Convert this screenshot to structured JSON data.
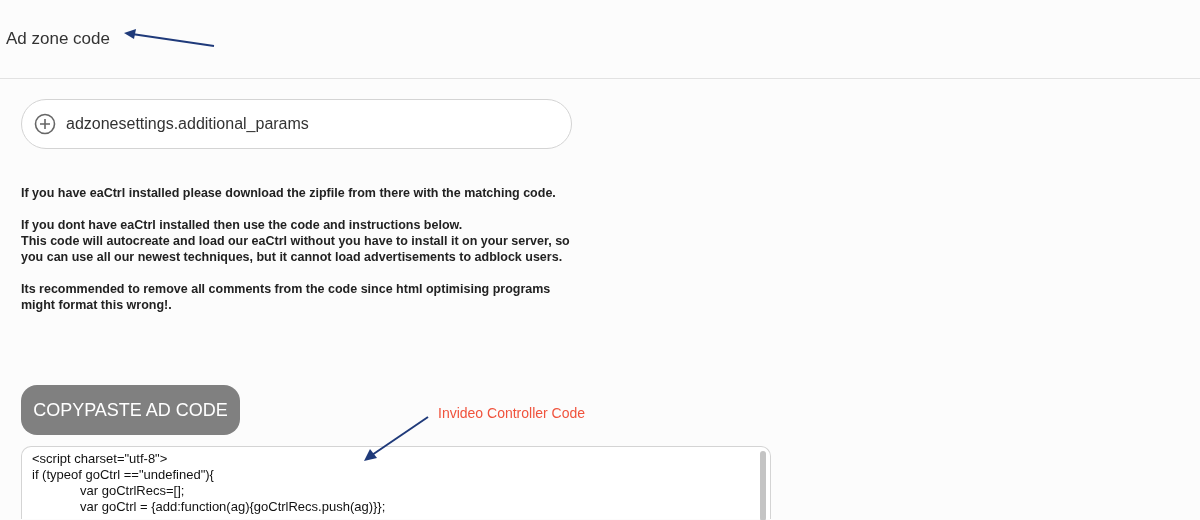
{
  "header": {
    "title": "Ad zone code"
  },
  "params_field": {
    "label": "adzonesettings.additional_params"
  },
  "paragraphs": [
    "If you have eaCtrl installed please download the zipfile from there with the matching code.",
    "If you dont have eaCtrl installed then use the code and instructions below.\nThis code will autocreate and load our eaCtrl without you have to install it on your server, so you can use all our newest techniques, but it cannot load advertisements to adblock users.",
    "Its recommended to remove all comments from the code since html optimising programs might format this wrong!."
  ],
  "copy_button": {
    "label": "COPYPASTE AD CODE"
  },
  "annotation": {
    "label": "Invideo Controller Code"
  },
  "code_lines": [
    {
      "text": "<script charset=\"utf-8\">",
      "indented": false
    },
    {
      "text": "if (typeof goCtrl ==\"undefined\"){",
      "indented": false
    },
    {
      "text": "var goCtrlRecs=[];",
      "indented": true
    },
    {
      "text": "var goCtrl = {add:function(ag){goCtrlRecs.push(ag)}};",
      "indented": true
    }
  ]
}
